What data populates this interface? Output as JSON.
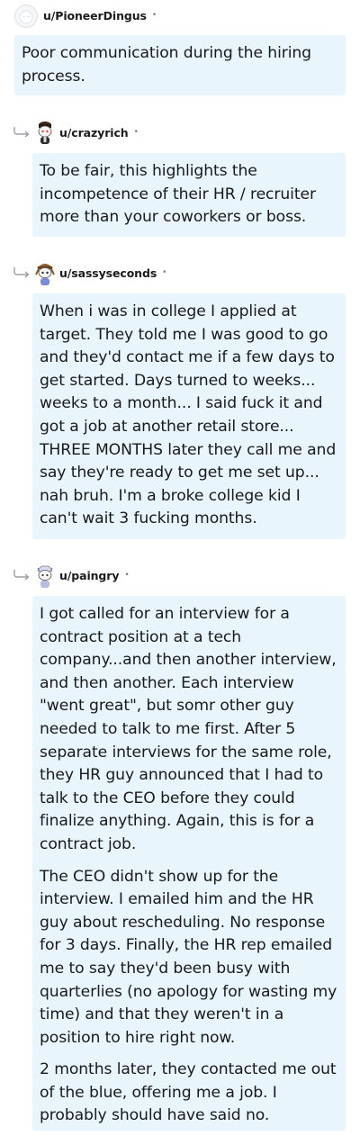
{
  "comments": [
    {
      "username": "u/PioneerDingus",
      "separator": "•",
      "paragraphs": [
        "Poor communication during the hiring process."
      ]
    },
    {
      "username": "u/crazyrich",
      "separator": "•",
      "paragraphs": [
        "To be fair, this highlights the incompetence of their HR / recruiter more than your coworkers or boss."
      ]
    },
    {
      "username": "u/sassyseconds",
      "separator": "•",
      "paragraphs": [
        "When i was in college I applied at target. They told me I was good to go and they'd contact me if a few days to get started. Days turned to weeks... weeks to a month... I said fuck it and got a job at another retail store... THREE MONTHS later they call me and say they're ready to get me set up... nah bruh. I'm a broke college kid I can't wait 3 fucking months."
      ]
    },
    {
      "username": "u/paingry",
      "separator": "•",
      "paragraphs": [
        "I got called for an interview for a contract position at a tech company...and then another interview, and then another. Each interview \"went great\", but somr other guy needed to talk to me first. After 5 separate interviews for the same role, they HR guy announced that I had to talk to the CEO before they could finalize anything. Again, this is for a contract job.",
        "The CEO didn't show up for the interview. I emailed him and the HR guy about rescheduling. No response for 3 days. Finally, the HR rep emailed me to say they'd been busy with quarterlies (no apology for wasting my time) and that they weren't in a position to hire right now.",
        "2 months later, they contacted me out of the blue, offering me a job. I probably should have said no."
      ]
    }
  ],
  "icons": {
    "reply": "reply-arrow-icon",
    "avatar_default": "default-avatar-icon",
    "avatar_crazyrich": "snoo-avatar-icon",
    "avatar_sassyseconds": "snoo-avatar-icon",
    "avatar_paingry": "snoo-avatar-icon"
  },
  "colors": {
    "bubble": "#e8f5fd",
    "text": "#1a1a1b",
    "meta": "#7c7c7c"
  }
}
